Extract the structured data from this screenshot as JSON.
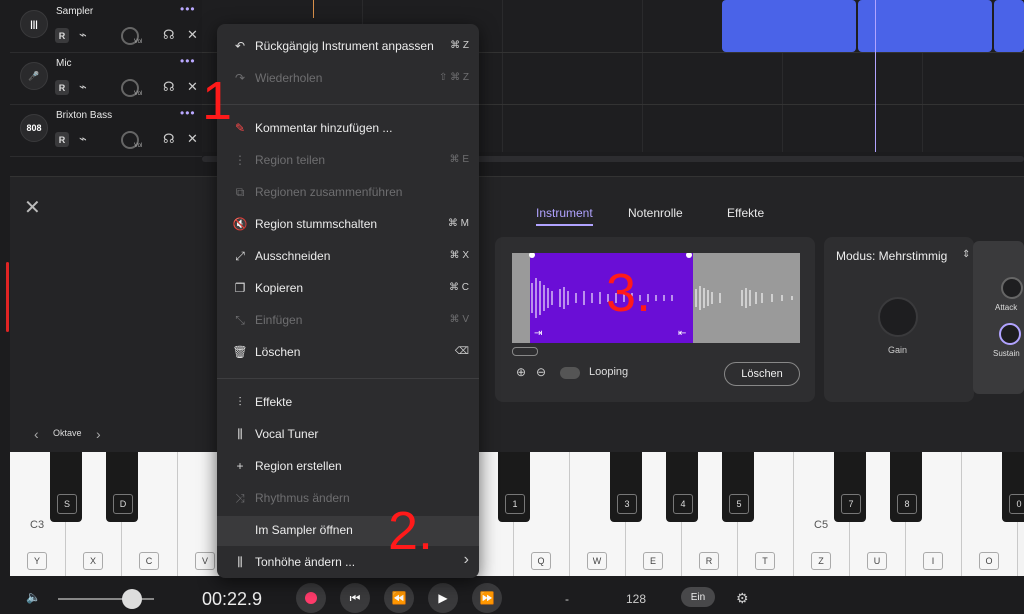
{
  "tracks": [
    {
      "name": "Sampler",
      "badge": "",
      "rec": "R",
      "vol": "Vol"
    },
    {
      "name": "Mic",
      "badge": "",
      "rec": "R",
      "vol": "Vol"
    },
    {
      "name": "Brixton Bass",
      "badge": "808",
      "rec": "R",
      "vol": "Vol"
    }
  ],
  "track_more": "•••",
  "editor": {
    "tabs": [
      "Instrument",
      "Notenrolle",
      "Effekte"
    ],
    "looping": "Looping",
    "delete": "Löschen",
    "mode": "Modus: Mehrstimmig",
    "gain": "Gain",
    "attack": "Attack",
    "sustain": "Sustain",
    "octave": "Oktave"
  },
  "keyboard": {
    "c3": "C3",
    "c5": "C5",
    "white_labels": [
      "Y",
      "X",
      "C",
      "V",
      "",
      "",
      "",
      "",
      "",
      "Q",
      "W",
      "E",
      "R",
      "T",
      "Z",
      "U",
      "I",
      "O"
    ],
    "black_labels": [
      "S",
      "D",
      "",
      "",
      "",
      "",
      "",
      "",
      "1",
      "",
      "3",
      "4",
      "5",
      "",
      "7",
      "8",
      "",
      "0"
    ]
  },
  "transport": {
    "time": "00:22.9",
    "dash": "-",
    "tempo": "128",
    "metronome": "Ein"
  },
  "menu": [
    {
      "label": "Rückgängig Instrument anpassen",
      "shortcut": "⌘ Z",
      "icon": "↶",
      "disabled": false
    },
    {
      "label": "Wiederholen",
      "shortcut": "⇧ ⌘ Z",
      "icon": "↷",
      "disabled": true
    },
    {
      "label": "Kommentar hinzufügen ...",
      "shortcut": "",
      "icon": "✎",
      "disabled": false
    },
    {
      "label": "Region teilen",
      "shortcut": "⌘ E",
      "icon": "⋮",
      "disabled": true
    },
    {
      "label": "Regionen zusammenführen",
      "shortcut": "",
      "icon": "⧉",
      "disabled": true
    },
    {
      "label": "Region stummschalten",
      "shortcut": "⌘ M",
      "icon": "🔇",
      "disabled": false
    },
    {
      "label": "Ausschneiden",
      "shortcut": "⌘ X",
      "icon": "⤢",
      "disabled": false
    },
    {
      "label": "Kopieren",
      "shortcut": "⌘ C",
      "icon": "❐",
      "disabled": false
    },
    {
      "label": "Einfügen",
      "shortcut": "⌘ V",
      "icon": "⤡",
      "disabled": true
    },
    {
      "label": "Löschen",
      "shortcut": "⌫",
      "icon": "🗑",
      "disabled": false
    },
    {
      "label": "Effekte",
      "shortcut": "",
      "icon": "⫶",
      "disabled": false
    },
    {
      "label": "Vocal Tuner",
      "shortcut": "",
      "icon": "⫼",
      "disabled": false
    },
    {
      "label": "Region erstellen",
      "shortcut": "",
      "icon": "+",
      "disabled": false
    },
    {
      "label": "Rhythmus ändern",
      "shortcut": "",
      "icon": "⤨",
      "disabled": true
    },
    {
      "label": "Im Sampler öffnen",
      "shortcut": "",
      "icon": "",
      "disabled": false
    },
    {
      "label": "Tonhöhe ändern ...",
      "shortcut": "›",
      "icon": "⫼",
      "disabled": false
    }
  ],
  "annotations": {
    "one": "1",
    "two": "2.",
    "three": "3."
  }
}
